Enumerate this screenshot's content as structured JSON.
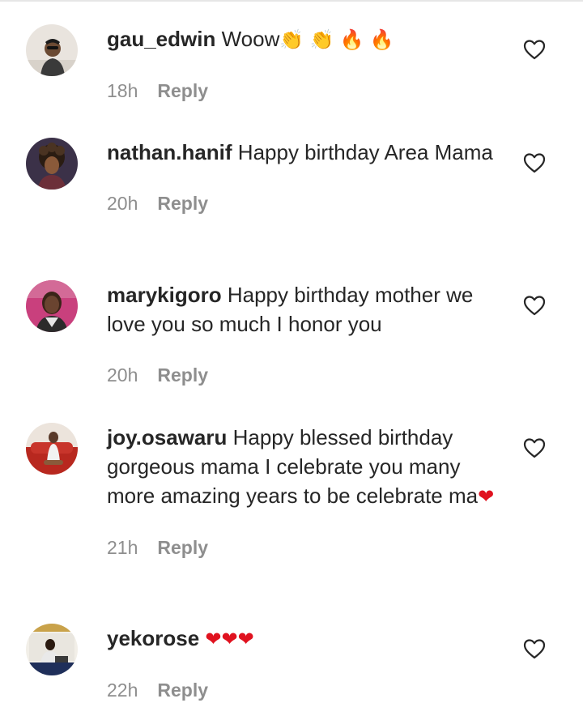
{
  "comments": [
    {
      "username": "gau_edwin",
      "text": "Woow",
      "emojis": [
        "👏",
        "👏",
        "🔥",
        "🔥"
      ],
      "time": "18h",
      "reply_label": "Reply",
      "avatar_icon": "avatar-man-sunglasses",
      "like_icon": "heart-outline-icon"
    },
    {
      "username": "nathan.hanif",
      "text": "Happy birthday Area Mama",
      "emojis": [],
      "time": "20h",
      "reply_label": "Reply",
      "avatar_icon": "avatar-curly-hair",
      "like_icon": "heart-outline-icon"
    },
    {
      "username": "marykigoro",
      "text": "Happy birthday mother we love you so much I honor you",
      "emojis": [],
      "time": "20h",
      "reply_label": "Reply",
      "avatar_icon": "avatar-woman-pink",
      "like_icon": "heart-outline-icon"
    },
    {
      "username": "joy.osawaru",
      "text": "Happy blessed birthday gorgeous mama I celebrate you many more amazing years to be celebrate ma",
      "emojis": [
        "❤"
      ],
      "time": "21h",
      "reply_label": "Reply",
      "avatar_icon": "avatar-woman-red-sofa",
      "like_icon": "heart-outline-icon"
    },
    {
      "username": "yekorose",
      "text": "",
      "emojis": [
        "❤",
        "❤",
        "❤"
      ],
      "time": "22h",
      "reply_label": "Reply",
      "avatar_icon": "avatar-man-sitting",
      "like_icon": "heart-outline-icon"
    }
  ],
  "colors": {
    "text": "#262626",
    "muted": "#8e8e8e",
    "heart_emoji": "#e0121f"
  }
}
